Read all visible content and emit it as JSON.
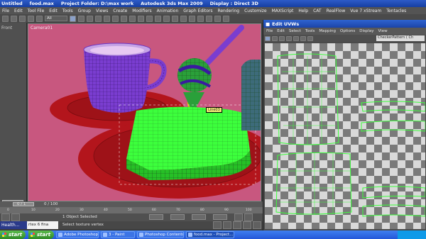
{
  "app": {
    "title_items": [
      "Untitled",
      "food.max",
      "Project Folder: D:\\max work",
      "Autodesk 3ds Max  2009",
      "Display : Direct 3D"
    ]
  },
  "menu": [
    "File",
    "Edit",
    "Tool File",
    "Edit",
    "Tools",
    "Group",
    "Views",
    "Create",
    "Modifiers",
    "Animation",
    "Graph Editors",
    "Rendering",
    "Customize",
    "MAXScript",
    "Help",
    "CAT",
    "RealFlow",
    "Vue 7 xStream",
    "Tentacles"
  ],
  "toolbar": {
    "view_combo": "All"
  },
  "left_panel": {
    "label": "Front",
    "buttons": [
      "",
      "",
      ""
    ]
  },
  "viewport": {
    "label": "Camera01",
    "object_label": "Line03"
  },
  "uvw_editor": {
    "title": "Edit UVWs",
    "menu": [
      "File",
      "Edit",
      "Select",
      "Tools",
      "Mapping",
      "Options",
      "Display",
      "View"
    ],
    "texture_combo": "CheckerPattern ( Ch"
  },
  "time_slider": {
    "label": "0 / 100",
    "frame_hint": "0 / 1"
  },
  "trackbar_ticks": [
    "0",
    "10",
    "20",
    "30",
    "40",
    "50",
    "60",
    "70",
    "80",
    "90",
    "100"
  ],
  "status": {
    "selection": "1 Object Selected",
    "prompt": "Select texture vertex",
    "maxscript_listener": "rtex 6 fina",
    "health": "Health..."
  },
  "taskbar": {
    "start_label": "start",
    "start2_label": "start",
    "tasks": [
      "Adobe Photoshop CS...",
      "3 - Paint",
      "Photoshop Contents ...",
      "food.max - Project..."
    ]
  },
  "colors": {
    "viewport_bg": "#c8577f",
    "wire_green": "#3cff3c",
    "plate_red": "#b3151c",
    "mug_purple": "#7a3dd0",
    "uv_edge": "#3cff3c"
  }
}
